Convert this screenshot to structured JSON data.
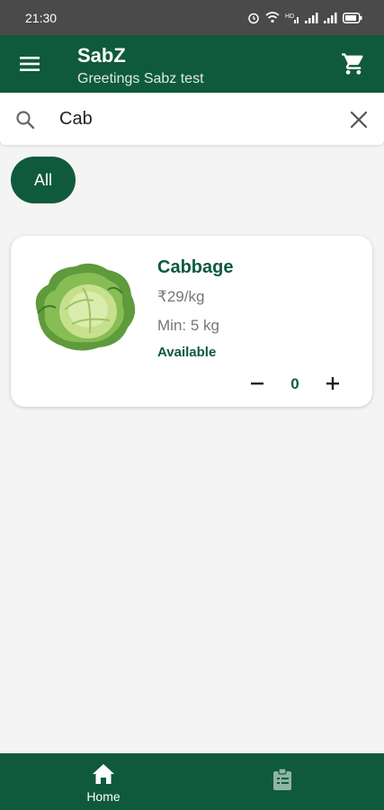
{
  "status_bar": {
    "time": "21:30",
    "icons": [
      "alarm-icon",
      "wifi-icon",
      "hd-signal-icon",
      "signal-icon",
      "signal-icon",
      "battery-icon"
    ]
  },
  "app_bar": {
    "title": "SabZ",
    "subtitle": "Greetings Sabz test",
    "menu_icon": "menu-icon",
    "cart_icon": "cart-icon"
  },
  "search": {
    "value": "Cab",
    "icon": "search-icon",
    "clear_icon": "close-icon"
  },
  "filters": {
    "chips": [
      {
        "label": "All",
        "selected": true
      }
    ]
  },
  "products": [
    {
      "name": "Cabbage",
      "price": "₹29/kg",
      "min": "Min: 5 kg",
      "status": "Available",
      "quantity": "0",
      "image_icon": "cabbage-image"
    }
  ],
  "bottom_nav": {
    "items": [
      {
        "label": "Home",
        "icon": "home-icon",
        "active": true
      },
      {
        "label": "",
        "icon": "clipboard-icon",
        "active": false
      }
    ]
  },
  "colors": {
    "brand": "#0f5a3d",
    "background": "#f4f4f4",
    "status_bar": "#4a4a4a"
  }
}
